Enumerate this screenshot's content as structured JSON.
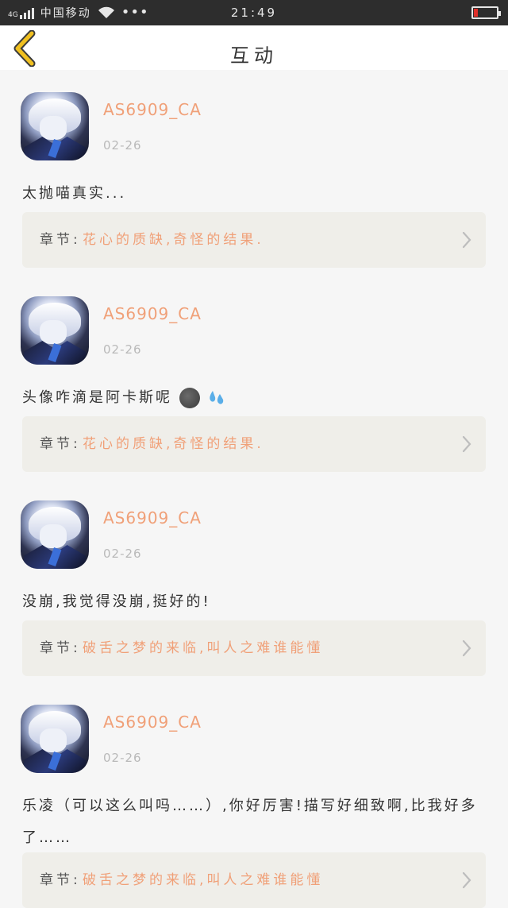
{
  "status_bar": {
    "network": "4G",
    "carrier": "中国移动",
    "dots": "•••",
    "time": "21:49",
    "battery_level": 0.15,
    "battery_color": "#e0302a"
  },
  "nav": {
    "back_icon": "chevron-left-icon",
    "title": "互动",
    "accent": "#f0c020"
  },
  "comments": [
    {
      "username": "AS6909_CA",
      "date": "02-26",
      "text": "太抛喵真实...",
      "chapter_label": "章节:",
      "chapter_title": "花心的质缺,奇怪的结果."
    },
    {
      "username": "AS6909_CA",
      "date": "02-26",
      "text": "头像咋滴是阿卡斯呢",
      "emojis": [
        "new-moon-face-emoji",
        "sweat-droplets-emoji"
      ],
      "chapter_label": "章节:",
      "chapter_title": "花心的质缺,奇怪的结果."
    },
    {
      "username": "AS6909_CA",
      "date": "02-26",
      "text": "没崩,我觉得没崩,挺好的!",
      "chapter_label": "章节:",
      "chapter_title": "破舌之梦的来临,叫人之难谁能懂"
    },
    {
      "username": "AS6909_CA",
      "date": "02-26",
      "text": "乐凌（可以这么叫吗……）,你好厉害!描写好细致啊,比我好多了……",
      "chapter_label": "章节:",
      "chapter_title": "破舌之梦的来临,叫人之难谁能懂"
    }
  ],
  "colors": {
    "username": "#f0a078",
    "chapter_title": "#f0a078",
    "chapter_bg": "#efeee9",
    "page_bg": "#f6f6f6"
  }
}
